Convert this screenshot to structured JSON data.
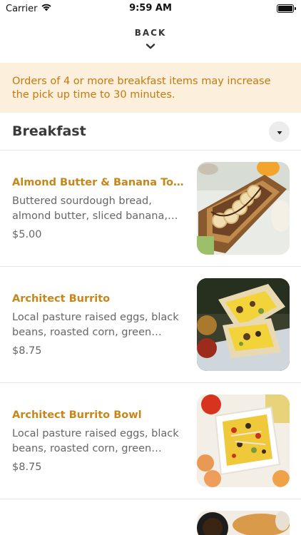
{
  "status_bar": {
    "carrier": "Carrier",
    "time": "9:59 AM",
    "wifi_icon": "wifi-icon",
    "battery_icon": "battery-icon"
  },
  "header": {
    "back_label": "BACK",
    "chevron_icon": "chevron-down-icon"
  },
  "notice": {
    "text": "Orders of 4 or more breakfast items may increase the pick up time to 30 minutes."
  },
  "section": {
    "title": "Breakfast",
    "toggle_icon": "caret-down-icon"
  },
  "menu_items": [
    {
      "name": "Almond Butter & Banana Toast",
      "description": "Buttered sourdough bread, almond butter, sliced banana, honey and s...",
      "price": "$5.00"
    },
    {
      "name": "Architect Burrito",
      "description": "Local pasture raised eggs, black beans, roasted corn, green chiles,...",
      "price": "$8.75"
    },
    {
      "name": "Architect Burrito Bowl",
      "description": "Local pasture raised eggs, black beans, roasted corn, green chiles,...",
      "price": "$8.75"
    }
  ],
  "colors": {
    "accent": "#c78619",
    "notice_bg": "#fcefdc",
    "notice_text": "#c3790f"
  }
}
